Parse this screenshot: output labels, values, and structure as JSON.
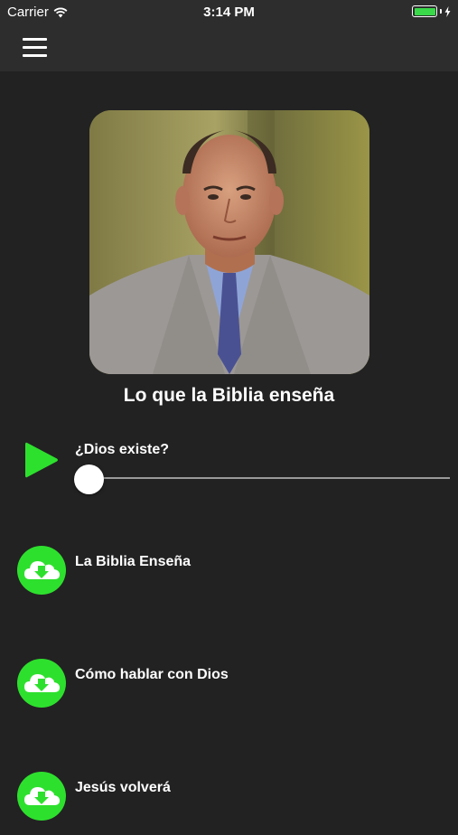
{
  "status_bar": {
    "carrier": "Carrier",
    "time": "3:14 PM"
  },
  "nav": {
    "menu_icon": "hamburger-menu-icon"
  },
  "album": {
    "title": "Lo que la Biblia enseña"
  },
  "player": {
    "track_title": "¿Dios existe?",
    "progress": 0
  },
  "tracks": [
    {
      "label": "La Biblia Enseña",
      "icon": "download-cloud-icon"
    },
    {
      "label": "Cómo hablar con Dios",
      "icon": "download-cloud-icon"
    },
    {
      "label": "Jesús volverá",
      "icon": "download-cloud-icon"
    }
  ],
  "colors": {
    "accent_green": "#2ee02e",
    "background": "#222222",
    "bar": "#2d2d2d",
    "battery": "#39d94a"
  }
}
